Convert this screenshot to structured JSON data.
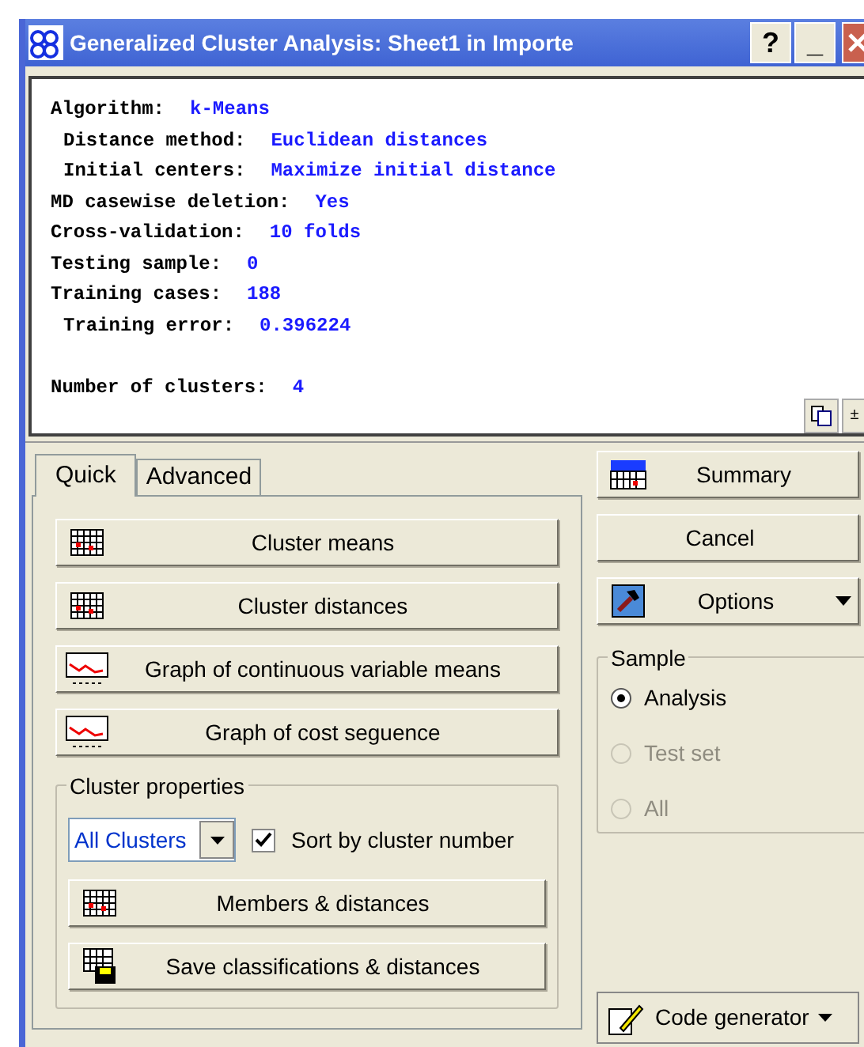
{
  "window": {
    "title": "Generalized Cluster Analysis: Sheet1 in Importe",
    "buttons": [
      "?",
      "_"
    ]
  },
  "output": [
    {
      "label": "Algorithm:",
      "value": "k-Means",
      "indented": false
    },
    {
      "label": "Distance method:",
      "value": "Euclidean distances",
      "indented": true
    },
    {
      "label": "Initial centers:",
      "value": "Maximize initial distance",
      "indented": true
    },
    {
      "label": "MD casewise deletion:",
      "value": "Yes",
      "indented": false
    },
    {
      "label": "Cross-validation:",
      "value": "10 folds",
      "indented": false
    },
    {
      "label": "Testing sample:",
      "value": "0",
      "indented": false
    },
    {
      "label": "Training cases:",
      "value": "188",
      "indented": false
    },
    {
      "label": "Training error:",
      "value": "0.396224",
      "indented": true
    },
    {
      "label": "Number of clusters:",
      "value": "4",
      "indented": false,
      "gap_before": true
    }
  ],
  "output_toolbar": [
    "±"
  ],
  "tabs": [
    {
      "label": "Quick",
      "selected": true
    },
    {
      "label": "Advanced",
      "selected": false
    }
  ],
  "quick_buttons": [
    {
      "label": "Cluster means",
      "kind": "table"
    },
    {
      "label": "Cluster distances",
      "kind": "table"
    },
    {
      "label": "Graph of continuous variable means",
      "kind": "graph"
    },
    {
      "label": "Graph of cost seguence",
      "kind": "graph"
    }
  ],
  "cluster_properties": {
    "title": "Cluster properties",
    "dropdown": {
      "value": "All Clusters"
    },
    "checkbox": {
      "label": "Sort by cluster number",
      "checked": true
    },
    "buttons": [
      {
        "label": "Members & distances",
        "kind": "table"
      },
      {
        "label": "Save classifications & distances",
        "kind": "save"
      }
    ]
  },
  "side_buttons": [
    {
      "label": "Summary",
      "kind": "summary"
    },
    {
      "label": "Cancel",
      "kind": "plain"
    },
    {
      "label": "Options",
      "kind": "options"
    }
  ],
  "sample": {
    "title": "Sample",
    "options": [
      {
        "label": "Analysis",
        "selected": true,
        "disabled": false
      },
      {
        "label": "Test set",
        "selected": false,
        "disabled": true
      },
      {
        "label": "All",
        "selected": false,
        "disabled": true
      }
    ]
  },
  "code_generator": {
    "label": "Code generator"
  }
}
